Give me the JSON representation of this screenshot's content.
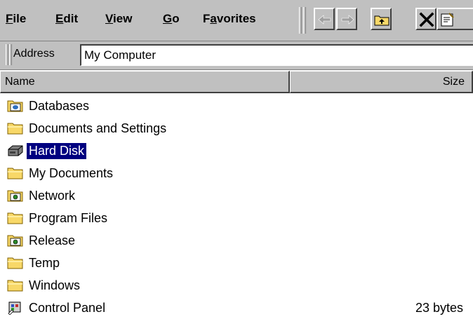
{
  "menubar": {
    "items": [
      {
        "label": "File",
        "mnemonic": "F",
        "rest": "ile"
      },
      {
        "label": "Edit",
        "mnemonic": "E",
        "rest": "dit"
      },
      {
        "label": "View",
        "mnemonic": "V",
        "rest": "iew"
      },
      {
        "label": "Go",
        "mnemonic": "G",
        "rest": "o"
      },
      {
        "label": "Favorites",
        "pre": "F",
        "mnemonic": "a",
        "rest": "vorites"
      }
    ]
  },
  "toolbar": {
    "buttons": [
      {
        "name": "back",
        "icon": "arrow-left-icon",
        "enabled": false
      },
      {
        "name": "forward",
        "icon": "arrow-right-icon",
        "enabled": false
      },
      {
        "name": "up",
        "icon": "up-folder-icon",
        "enabled": true
      },
      {
        "name": "delete",
        "icon": "delete-x-icon",
        "enabled": true
      },
      {
        "name": "properties",
        "icon": "properties-icon",
        "enabled": true
      }
    ]
  },
  "address": {
    "label": "Address",
    "value": "My Computer"
  },
  "columns": {
    "name": "Name",
    "size": "Size"
  },
  "items": [
    {
      "name": "Databases",
      "size": "",
      "icon": "database-folder-icon",
      "selected": false
    },
    {
      "name": "Documents and Settings",
      "size": "",
      "icon": "folder-icon",
      "selected": false
    },
    {
      "name": "Hard Disk",
      "size": "",
      "icon": "hard-disk-icon",
      "selected": true
    },
    {
      "name": "My Documents",
      "size": "",
      "icon": "folder-icon",
      "selected": false
    },
    {
      "name": "Network",
      "size": "",
      "icon": "network-folder-icon",
      "selected": false
    },
    {
      "name": "Program Files",
      "size": "",
      "icon": "folder-icon",
      "selected": false
    },
    {
      "name": "Release",
      "size": "",
      "icon": "network-folder-icon",
      "selected": false
    },
    {
      "name": "Temp",
      "size": "",
      "icon": "folder-icon",
      "selected": false
    },
    {
      "name": "Windows",
      "size": "",
      "icon": "folder-icon",
      "selected": false
    },
    {
      "name": "Control Panel",
      "size": "23 bytes",
      "icon": "control-panel-icon",
      "selected": false
    }
  ],
  "colors": {
    "chrome": "#c0c0c0",
    "selection": "#000080",
    "folder": "#f8d868"
  }
}
